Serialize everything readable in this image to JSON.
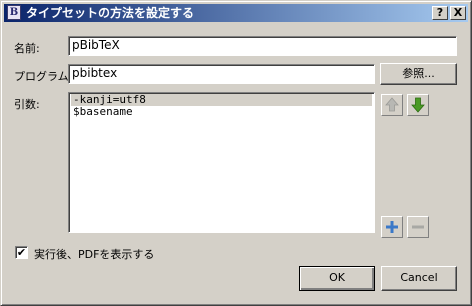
{
  "window": {
    "title": "タイプセットの方法を設定する",
    "help": "?",
    "close": "X"
  },
  "form": {
    "name_label": "名前:",
    "name_value": "pBibTeX",
    "program_label": "プログラム:",
    "program_value": "pbibtex",
    "browse_label": "参照...",
    "args_label": "引数:",
    "args": [
      "-kanji=utf8",
      "$basename"
    ]
  },
  "options": {
    "show_pdf_label": "実行後、PDFを表示する",
    "show_pdf_checked": "✔"
  },
  "buttons": {
    "ok": "OK",
    "cancel": "Cancel"
  },
  "colors": {
    "arrow_green": "#4a9a24",
    "plus_blue": "#3a78c8"
  }
}
